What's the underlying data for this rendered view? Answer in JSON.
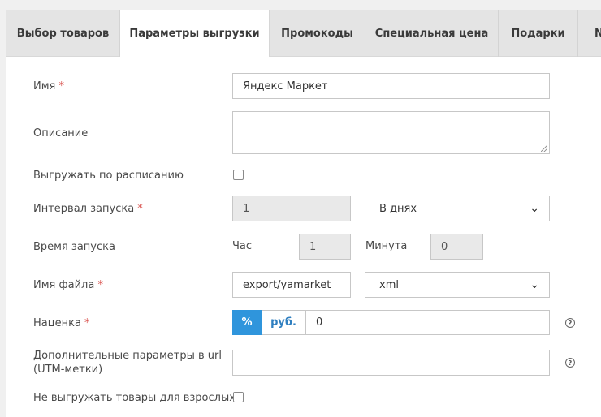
{
  "tabs": [
    {
      "label": "Выбор товаров"
    },
    {
      "label": "Параметры выгрузки"
    },
    {
      "label": "Промокоды"
    },
    {
      "label": "Специальная цена"
    },
    {
      "label": "Подарки"
    },
    {
      "label": "N"
    }
  ],
  "form": {
    "name": {
      "label": "Имя",
      "required_mark": "*",
      "value": "Яндекс Маркет"
    },
    "description": {
      "label": "Описание",
      "value": ""
    },
    "schedule": {
      "label": "Выгружать по расписанию",
      "checked": false
    },
    "interval": {
      "label": "Интервал запуска",
      "required_mark": "*",
      "value": "1",
      "unit": "В днях"
    },
    "start_time": {
      "label": "Время запуска",
      "hour_label": "Час",
      "hour_value": "1",
      "minute_label": "Минута",
      "minute_value": "0"
    },
    "filename": {
      "label": "Имя файла",
      "required_mark": "*",
      "value": "export/yamarket",
      "format": "xml"
    },
    "markup": {
      "label": "Наценка",
      "required_mark": "*",
      "pct_label": "%",
      "rub_label": "руб.",
      "value": "0",
      "help_icon": "question-circle-icon"
    },
    "utm": {
      "label_line1": "Дополнительные параметры в url",
      "label_line2": "(UTM-метки)",
      "value": "",
      "help_icon": "question-circle-icon"
    },
    "no_adult": {
      "label": "Не выгружать товары для взрослых",
      "checked": false
    }
  },
  "colors": {
    "accent": "#2f95dc",
    "required": "#d9534f"
  }
}
